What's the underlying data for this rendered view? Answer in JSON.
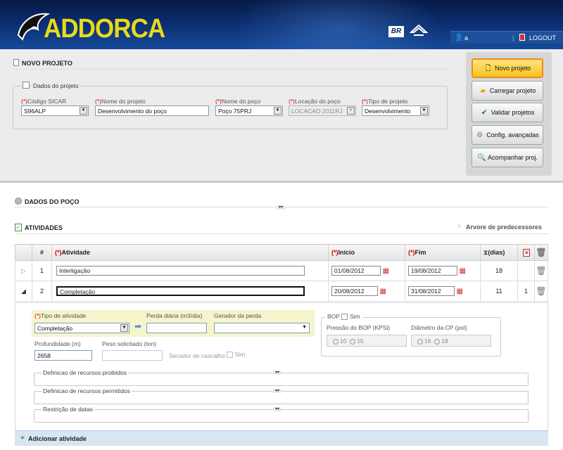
{
  "header": {
    "logo_text": "ADDORCA",
    "br_badge": "BR",
    "username": "a",
    "logout_label": "LOGOUT"
  },
  "project": {
    "section_title": "NOVO PROJETO",
    "fieldset_title": "Dados do projeto",
    "required_mark": "(*)",
    "fields": {
      "sicar": {
        "label": "Código SICAR",
        "value": "S96ALP"
      },
      "nome_projeto": {
        "label": "Nome do projeto",
        "value": "Desenvolvimento do poço"
      },
      "nome_poco": {
        "label": "Nome do poço",
        "value": "Poço 75PRJ"
      },
      "locacao": {
        "label": "Locação do poço",
        "value": "LOCACAO 2011RJ"
      },
      "tipo": {
        "label": "Tipo de projeto",
        "value": "Desenvolvimento"
      }
    }
  },
  "side_buttons": [
    {
      "label": "Novo projeto",
      "icon": "document-icon"
    },
    {
      "label": "Carregar projeto",
      "icon": "folder-icon"
    },
    {
      "label": "Validar projetos",
      "icon": "checkmark-icon"
    },
    {
      "label": "Config. avançadas",
      "icon": "gear-icon"
    },
    {
      "label": "Acompanhar proj.",
      "icon": "magnifier-icon"
    }
  ],
  "dados_poco": {
    "title": "DADOS DO POÇO"
  },
  "atividades": {
    "title": "ATIVIDADES",
    "tree_link": "Arvore de predecessores",
    "columns": {
      "num": "#",
      "atividade": "Atividade",
      "inicio": "Início",
      "fim": "Fim",
      "dias": "(dias)"
    },
    "rows": [
      {
        "num": "1",
        "atividade": "Interligação",
        "inicio": "01/08/2012",
        "fim": "19/08/2012",
        "dias": "18",
        "pred": ""
      },
      {
        "num": "2",
        "atividade": "Completação",
        "inicio": "20/08/2012",
        "fim": "31/08/2012",
        "dias": "11",
        "pred": "1"
      }
    ]
  },
  "detail": {
    "tipo_atividade_label": "Tipo de atividade",
    "tipo_atividade_value": "Completação",
    "perda_label": "Perda diária (m3/dia)",
    "perda_value": "",
    "gerador_label": "Gerador da perda",
    "gerador_value": "",
    "profundidade_label": "Profundidade (m)",
    "profundidade_value": "2658",
    "peso_label": "Peso solicitado (ton)",
    "peso_value": "",
    "secador_label": "Secador de cascalho",
    "sim_label": "Sim",
    "bop_label": "BOP",
    "bop_sim_label": "Sim",
    "pressao_label": "Pressão do BOP (KPSi)",
    "pressao_options": [
      "10",
      "15"
    ],
    "diametro_label": "Diâmetro da CP (pol)",
    "diametro_options": [
      "16",
      "18"
    ],
    "collapsibles": [
      "Definicao de recursos proibidos",
      "Definicao de recursos permitidos",
      "Restrição de datas"
    ],
    "add_activity": "Adicionar atividade"
  },
  "colors": {
    "accent": "#f7c21c",
    "header": "#0b2c6e",
    "required": "#dd0000"
  }
}
